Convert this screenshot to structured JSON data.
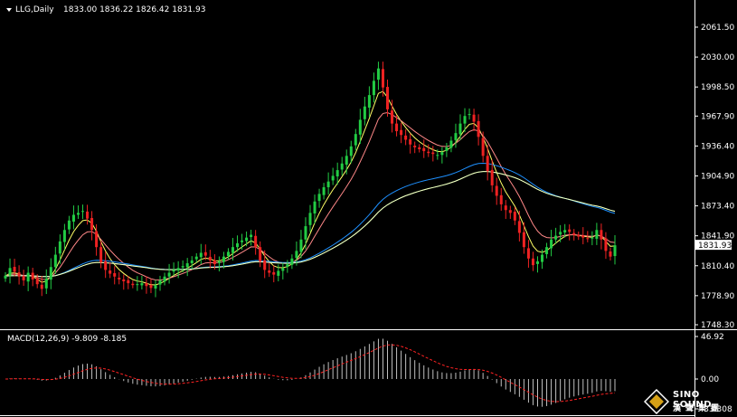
{
  "header": {
    "symbol_title": "LLG,Daily",
    "ohlc": "1833.00 1836.22 1826.42 1831.93"
  },
  "macd_header": "MACD(12,26,9) -9.809 -8.185",
  "current_price_label": "1831.93",
  "logo": {
    "brand_en": "SINO SOUND",
    "brand_cn": "漢聲集團"
  },
  "colors": {
    "background": "#000000",
    "up_candle": "#22cc44",
    "down_candle": "#ee2222",
    "grid_border": "#ffffff",
    "ma5": "#ffff66",
    "ma10": "#ff8888",
    "ma50": "#1e90ff",
    "ma100": "#33cc33",
    "ma200": "#ffffcc",
    "macd_hist": "#c0c0c0",
    "macd_signal": "#ff2222"
  },
  "chart_data": {
    "type": "candlestick",
    "price_axis": {
      "ticks": [
        "2061.50",
        "2030.00",
        "1998.50",
        "1967.90",
        "1936.40",
        "1904.90",
        "1873.40",
        "1841.90",
        "1810.40",
        "1778.90",
        "1748.30"
      ],
      "range": [
        1748.3,
        2073
      ]
    },
    "macd_axis": {
      "ticks": [
        "46.92",
        "0.00",
        "-33.308"
      ],
      "range": [
        -33.308,
        46.92
      ]
    },
    "closes": [
      1800,
      1808,
      1804,
      1799,
      1795,
      1803,
      1796,
      1791,
      1786,
      1797,
      1809,
      1822,
      1836,
      1848,
      1858,
      1864,
      1866,
      1868,
      1860,
      1848,
      1830,
      1814,
      1806,
      1802,
      1799,
      1796,
      1794,
      1792,
      1790,
      1791,
      1792,
      1789,
      1787,
      1790,
      1795,
      1799,
      1803,
      1806,
      1808,
      1810,
      1813,
      1816,
      1820,
      1824,
      1821,
      1816,
      1812,
      1815,
      1820,
      1825,
      1830,
      1834,
      1837,
      1840,
      1843,
      1830,
      1815,
      1806,
      1803,
      1801,
      1805,
      1808,
      1812,
      1818,
      1826,
      1838,
      1852,
      1866,
      1878,
      1886,
      1893,
      1899,
      1905,
      1911,
      1918,
      1926,
      1936,
      1949,
      1964,
      1978,
      1990,
      2005,
      2018,
      1998,
      1975,
      1960,
      1952,
      1948,
      1943,
      1938,
      1935,
      1933,
      1931,
      1929,
      1928,
      1927,
      1930,
      1935,
      1942,
      1950,
      1960,
      1968,
      1970,
      1962,
      1946,
      1926,
      1910,
      1895,
      1884,
      1875,
      1869,
      1866,
      1858,
      1845,
      1830,
      1818,
      1811,
      1815,
      1822,
      1830,
      1838,
      1842,
      1846,
      1848,
      1846,
      1843,
      1841,
      1840,
      1839,
      1840,
      1848,
      1838,
      1826,
      1820,
      1831.93
    ],
    "ma": [
      {
        "period": 5,
        "color_key": "ma5"
      },
      {
        "period": 10,
        "color_key": "ma10"
      },
      {
        "period": 50,
        "color_key": "ma50"
      },
      {
        "period": 100,
        "color_key": "ma100"
      },
      {
        "period": 200,
        "color_key": "ma200"
      }
    ],
    "macd_params": [
      12,
      26,
      9
    ],
    "macd_last": -9.809,
    "signal_last": -8.185,
    "grid": false,
    "legend": "none"
  }
}
